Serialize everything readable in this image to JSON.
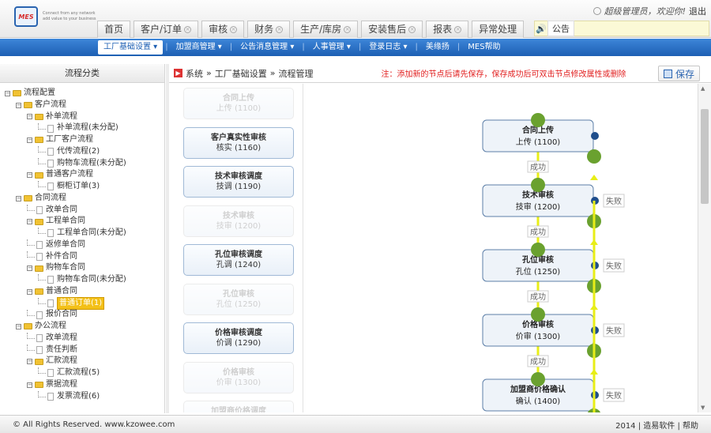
{
  "header": {
    "logo_text": "MES",
    "tagline": "Connect from any network add value to your business",
    "tabs": [
      {
        "label": "首页",
        "closable": false
      },
      {
        "label": "客户/订单",
        "closable": true
      },
      {
        "label": "审核",
        "closable": true
      },
      {
        "label": "财务",
        "closable": true
      },
      {
        "label": "生产/库房",
        "closable": true
      },
      {
        "label": "安装售后",
        "closable": true
      },
      {
        "label": "报表",
        "closable": true
      },
      {
        "label": "异常处理",
        "closable": false
      }
    ],
    "notice_label": "公告",
    "user_text": "超级管理员，欢迎你!",
    "logout_label": "退出"
  },
  "navbar": {
    "items": [
      {
        "label": "工厂基础设置 ▾",
        "selected": true
      },
      {
        "label": "加盟商管理 ▾",
        "selected": false
      },
      {
        "label": "公告消息管理 ▾",
        "selected": false
      },
      {
        "label": "人事管理 ▾",
        "selected": false
      },
      {
        "label": "登录日志 ▾",
        "selected": false
      },
      {
        "label": "美缘扬",
        "selected": false
      },
      {
        "label": "MES帮助",
        "selected": false
      }
    ]
  },
  "sidebar": {
    "title": "流程分类",
    "tree": [
      {
        "label": "流程配置",
        "depth": 0,
        "type": "folder",
        "open": true
      },
      {
        "label": "客户流程",
        "depth": 1,
        "type": "folder",
        "open": true
      },
      {
        "label": "补单流程",
        "depth": 2,
        "type": "folder",
        "open": true
      },
      {
        "label": "补单流程(未分配)",
        "depth": 3,
        "type": "doc"
      },
      {
        "label": "工厂客户流程",
        "depth": 2,
        "type": "folder",
        "open": true
      },
      {
        "label": "代传流程(2)",
        "depth": 3,
        "type": "doc"
      },
      {
        "label": "购物车流程(未分配)",
        "depth": 3,
        "type": "doc"
      },
      {
        "label": "普通客户流程",
        "depth": 2,
        "type": "folder",
        "open": true
      },
      {
        "label": "橱柜订单(3)",
        "depth": 3,
        "type": "doc"
      },
      {
        "label": "合同流程",
        "depth": 1,
        "type": "folder",
        "open": true
      },
      {
        "label": "改单合同",
        "depth": 2,
        "type": "doc"
      },
      {
        "label": "工程单合同",
        "depth": 2,
        "type": "folder",
        "open": true
      },
      {
        "label": "工程单合同(未分配)",
        "depth": 3,
        "type": "doc"
      },
      {
        "label": "返修单合同",
        "depth": 2,
        "type": "doc"
      },
      {
        "label": "补件合同",
        "depth": 2,
        "type": "doc"
      },
      {
        "label": "购物车合同",
        "depth": 2,
        "type": "folder",
        "open": true
      },
      {
        "label": "购物车合同(未分配)",
        "depth": 3,
        "type": "doc"
      },
      {
        "label": "普通合同",
        "depth": 2,
        "type": "folder",
        "open": true
      },
      {
        "label": "普通订单(1)",
        "depth": 3,
        "type": "doc",
        "selected": true
      },
      {
        "label": "报价合同",
        "depth": 2,
        "type": "doc"
      },
      {
        "label": "办公流程",
        "depth": 1,
        "type": "folder",
        "open": true
      },
      {
        "label": "改单流程",
        "depth": 2,
        "type": "doc"
      },
      {
        "label": "责任判断",
        "depth": 2,
        "type": "doc"
      },
      {
        "label": "汇款流程",
        "depth": 2,
        "type": "folder",
        "open": true
      },
      {
        "label": "汇款流程(5)",
        "depth": 3,
        "type": "doc"
      },
      {
        "label": "票据流程",
        "depth": 2,
        "type": "folder",
        "open": true
      },
      {
        "label": "发票流程(6)",
        "depth": 3,
        "type": "doc"
      }
    ]
  },
  "main": {
    "breadcrumb": [
      "系统",
      "工厂基础设置",
      "流程管理"
    ],
    "warning": "注：添加新的节点后请先保存，保存成功后可双击节点修改属性或删除",
    "save_label": "保存",
    "palette": [
      {
        "title": "合同上传",
        "sub": "上传 (1100)",
        "disabled": true
      },
      {
        "title": "客户真实性审核",
        "sub": "核实 (1160)",
        "disabled": false
      },
      {
        "title": "技术审核调度",
        "sub": "技调 (1190)",
        "disabled": false
      },
      {
        "title": "技术审核",
        "sub": "技审 (1200)",
        "disabled": true
      },
      {
        "title": "孔位审核调度",
        "sub": "孔调 (1240)",
        "disabled": false
      },
      {
        "title": "孔位审核",
        "sub": "孔位 (1250)",
        "disabled": true
      },
      {
        "title": "价格审核调度",
        "sub": "价调 (1290)",
        "disabled": false
      },
      {
        "title": "价格审核",
        "sub": "价审 (1300)",
        "disabled": true
      },
      {
        "title": "加盟商价格调度",
        "sub": "",
        "disabled": true
      }
    ],
    "flow_nodes": [
      {
        "title": "合同上传",
        "sub": "上传 (1100)"
      },
      {
        "title": "技术审核",
        "sub": "技审 (1200)"
      },
      {
        "title": "孔位审核",
        "sub": "孔位 (1250)"
      },
      {
        "title": "价格审核",
        "sub": "价审 (1300)"
      },
      {
        "title": "加盟商价格确认",
        "sub": "确认 (1400)"
      }
    ],
    "success_label": "成功",
    "fail_label": "失败",
    "colors": {
      "green": "#6aa12f",
      "yellow": "#e8ee17",
      "blue": "#1f4e8c",
      "node_border": "#5d7fa8"
    }
  },
  "footer": {
    "copyright": "© All Rights Reserved. www.kzowee.com",
    "right": "2014 | 造易软件 | 帮助"
  }
}
